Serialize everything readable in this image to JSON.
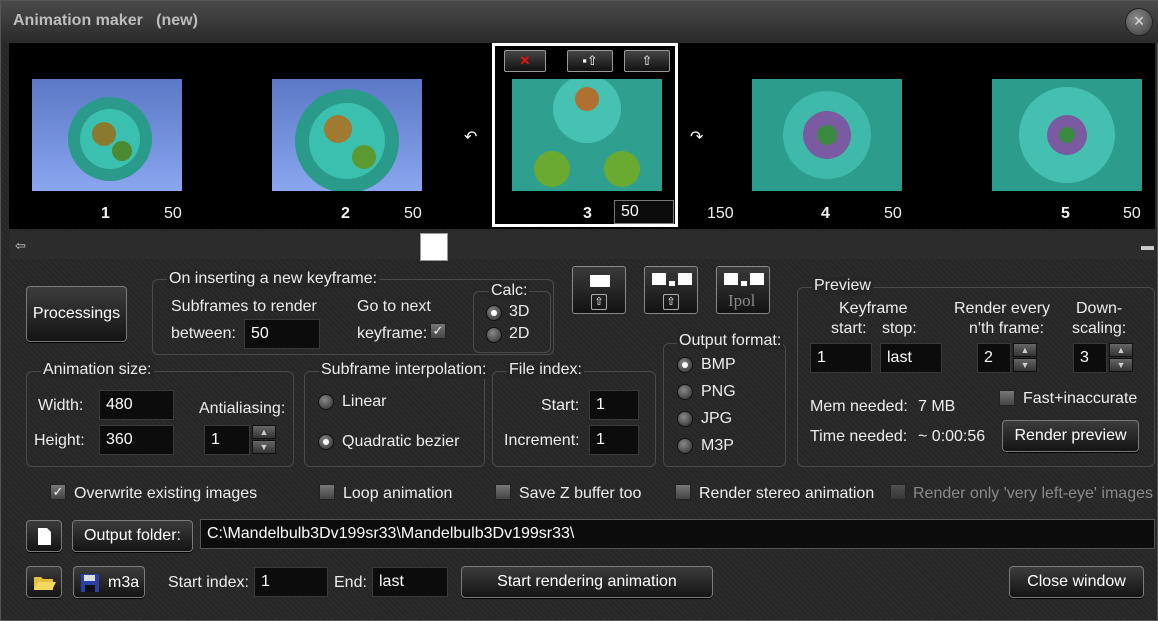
{
  "window": {
    "title": "Animation maker   (new)",
    "close_label": "×"
  },
  "keyframes": [
    {
      "index": "1",
      "subframes": "50"
    },
    {
      "index": "2",
      "subframes": "50"
    },
    {
      "index": "3",
      "subframes": "50"
    },
    {
      "index": "4",
      "subframes": "50"
    },
    {
      "index": "5",
      "subframes": "50"
    }
  ],
  "selected_extra_value": "150",
  "thumb_buttons": {
    "delete": "✕",
    "move_left": "▪⇧",
    "up": "⇧"
  },
  "processings_label": "Processings",
  "insert_group": {
    "title": "On inserting a new keyframe:",
    "subframes_label_1": "Subframes to render",
    "subframes_label_2": "between:",
    "subframes_value": "50",
    "goto_label_1": "Go to next",
    "goto_label_2": "keyframe:",
    "calc_title": "Calc:",
    "calc_options": [
      "3D",
      "2D"
    ]
  },
  "keyframe_buttons": {
    "ipol_label": "Ipol"
  },
  "output_format": {
    "title": "Output format:",
    "options": [
      "BMP",
      "PNG",
      "JPG",
      "M3P"
    ],
    "selected": "BMP"
  },
  "animation_size": {
    "title": "Animation size:",
    "width_label": "Width:",
    "width_value": "480",
    "height_label": "Height:",
    "height_value": "360",
    "antialias_label": "Antialiasing:",
    "antialias_value": "1"
  },
  "interpolation": {
    "title": "Subframe interpolation:",
    "options": [
      "Linear",
      "Quadratic bezier"
    ],
    "selected": "Quadratic bezier"
  },
  "file_index": {
    "title": "File index:",
    "start_label": "Start:",
    "start_value": "1",
    "increment_label": "Increment:",
    "increment_value": "1"
  },
  "preview": {
    "title": "Preview",
    "keyframe_label": "Keyframe",
    "start_label": "start:",
    "stop_label": "stop:",
    "start_value": "1",
    "stop_value": "last",
    "render_every_label_1": "Render every",
    "render_every_label_2": "n'th frame:",
    "render_every_value": "2",
    "downscaling_label_1": "Down-",
    "downscaling_label_2": "scaling:",
    "downscaling_value": "3",
    "mem_label": "Mem needed:",
    "mem_value": "7 MB",
    "time_label": "Time needed:",
    "time_value": "~ 0:00:56",
    "fast_label": "Fast+inaccurate",
    "render_button": "Render preview"
  },
  "options": {
    "overwrite": "Overwrite existing images",
    "loop": "Loop animation",
    "savez": "Save Z buffer too",
    "stereo": "Render stereo animation",
    "lefteye": "Render only 'very left-eye' images"
  },
  "output_folder": {
    "button": "Output folder:",
    "path": "C:\\Mandelbulb3Dv199sr33\\Mandelbulb3Dv199sr33\\"
  },
  "bottom": {
    "m3a_label": "m3a",
    "start_index_label": "Start index:",
    "start_index_value": "1",
    "end_label": "End:",
    "end_value": "last",
    "start_render_button": "Start rendering animation",
    "close_button": "Close window"
  },
  "colors": {
    "accent_white": "#ffffff",
    "thumb_sky": "#6f8fe0",
    "fractal_teal": "#2fb0a0"
  }
}
